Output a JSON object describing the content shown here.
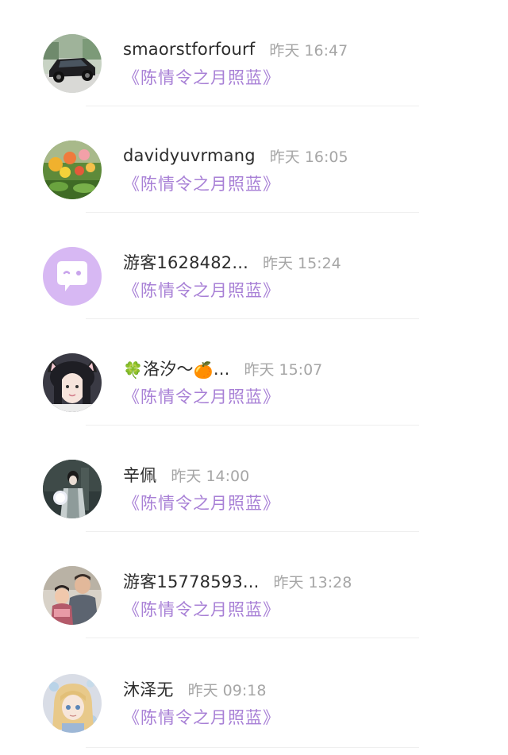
{
  "comments": [
    {
      "user": "smaorstforfourf",
      "time": "昨天 16:47",
      "work": "《陈情令之月照蓝》",
      "avatar": "car-photo-avatar"
    },
    {
      "user": "davidyuvrmang",
      "time": "昨天 16:05",
      "work": "《陈情令之月照蓝》",
      "avatar": "flowers-photo-avatar"
    },
    {
      "user": "游客1628482...",
      "time": "昨天 15:24",
      "work": "《陈情令之月照蓝》",
      "avatar": "default-chat-avatar"
    },
    {
      "user_prefix_icon": "four-leaf-clover-emoji",
      "user": "洛汐～",
      "user_suffix_icon": "tangerine-emoji",
      "user_suffix": "...",
      "time": "昨天 15:07",
      "work": "《陈情令之月照蓝》",
      "avatar": "cat-ears-girl-avatar"
    },
    {
      "user": "辛佩",
      "time": "昨天 14:00",
      "work": "《陈情令之月照蓝》",
      "avatar": "ancient-costume-figure-avatar"
    },
    {
      "user": "游客15778593...",
      "time": "昨天 13:28",
      "work": "《陈情令之月照蓝》",
      "avatar": "family-photo-avatar"
    },
    {
      "user": "沐泽无",
      "time": "昨天 09:18",
      "work": "《陈情令之月照蓝》",
      "avatar": "anime-girl-avatar"
    }
  ],
  "colors": {
    "username": "#2c2c2c",
    "timestamp": "#a6a6a6",
    "work_link": "#a880d6",
    "default_avatar_bg": "#d7b8f3",
    "divider": "#efefef"
  }
}
